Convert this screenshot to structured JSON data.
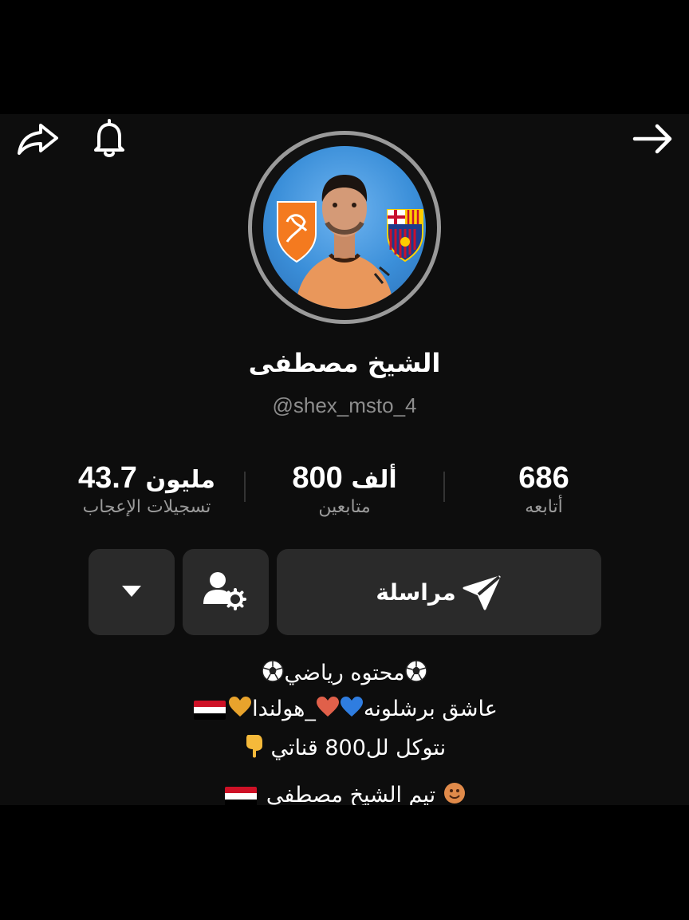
{
  "profile": {
    "display_name": "الشيخ مصطفى",
    "handle": "@shex_msto_4"
  },
  "stats": {
    "following": {
      "value": "686",
      "unit": "",
      "label": "أتابعه"
    },
    "followers": {
      "value": "800",
      "unit": "ألف",
      "label": "متابعين"
    },
    "likes": {
      "value": "43.7",
      "unit": "مليون",
      "label": "تسجيلات الإعجاب"
    }
  },
  "actions": {
    "message_label": "مراسلة"
  },
  "bio": {
    "line1": "محتوه رياضي",
    "line2_a": "عاشق برشلونه",
    "line2_b": "_هولندا",
    "line3": "نتوكل لل800 قناتي",
    "line4": "تيم الشيخ مصطفى"
  },
  "icons": [
    "back-arrow-icon",
    "share-icon",
    "bell-icon",
    "send-icon",
    "person-settings-icon",
    "caret-down-icon",
    "soccer-ball-icon",
    "heart-icon",
    "egypt-flag-icon",
    "pointing-down-icon",
    "smiley-icon"
  ],
  "colors": {
    "background": "#0d0d0d",
    "button": "#2a2a2a",
    "secondary_text": "#9a9a9a",
    "avatar_bg": "#3b8fd9"
  }
}
